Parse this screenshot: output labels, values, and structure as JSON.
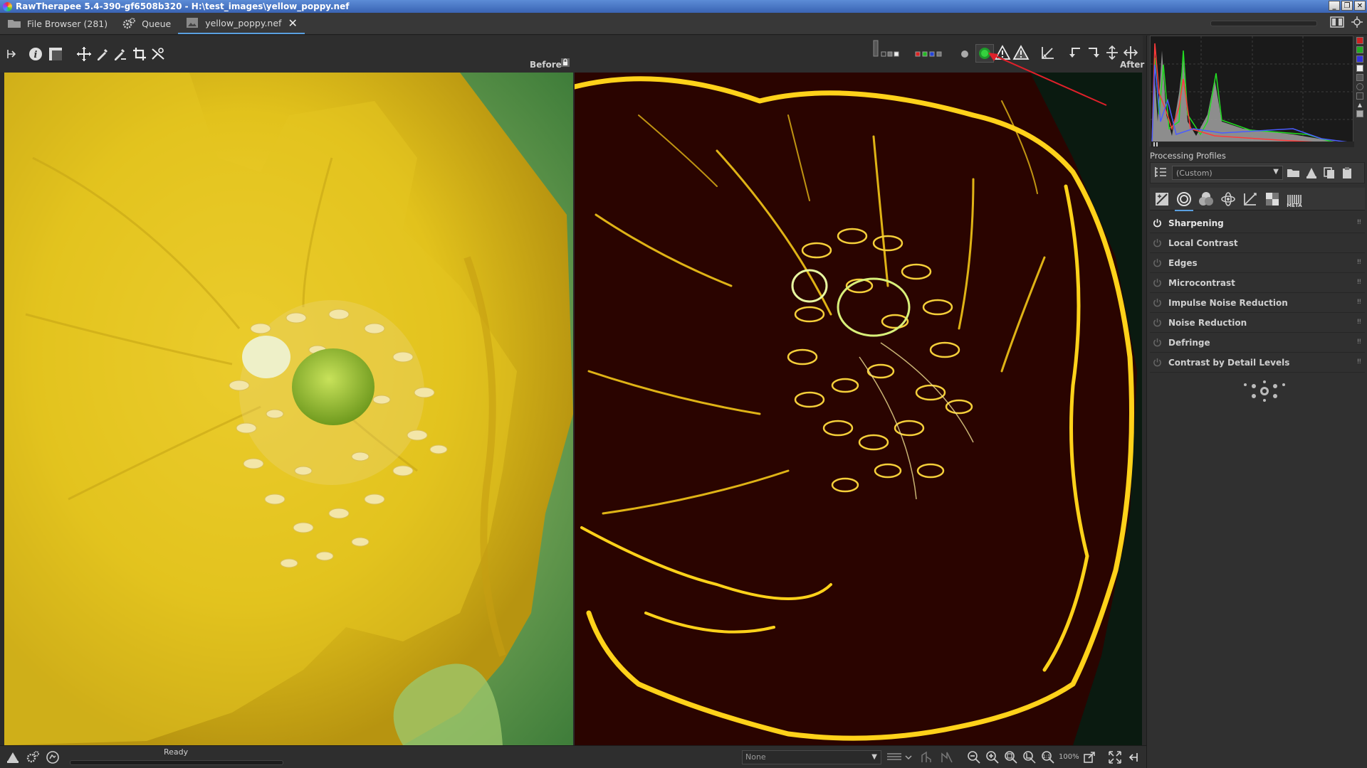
{
  "window": {
    "title": "RawTherapee 5.4-390-gf6508b320 - H:\\test_images\\yellow_poppy.nef",
    "controls": [
      "_",
      "❐",
      "✕"
    ]
  },
  "tabs": [
    {
      "label": "File Browser (281)",
      "icon": "folder-icon"
    },
    {
      "label": "Queue",
      "icon": "gears-icon"
    },
    {
      "label": "yellow_poppy.nef",
      "icon": "image-icon",
      "active": true
    }
  ],
  "toolbar": {
    "before_label": "Before",
    "after_label": "After"
  },
  "processing_profiles": {
    "title": "Processing Profiles",
    "selected": "(Custom)"
  },
  "tool_tabs": [
    {
      "icon": "exposure-tab-icon"
    },
    {
      "icon": "detail-tab-icon",
      "active": true
    },
    {
      "icon": "color-tab-icon"
    },
    {
      "icon": "advanced-tab-icon"
    },
    {
      "icon": "transform-tab-icon"
    },
    {
      "icon": "raw-tab-icon"
    },
    {
      "icon": "metadata-tab-icon",
      "label": "META"
    }
  ],
  "tools": [
    {
      "label": "Sharpening",
      "enabled": true
    },
    {
      "label": "Local Contrast",
      "enabled": false
    },
    {
      "label": "Edges",
      "enabled": false
    },
    {
      "label": "Microcontrast",
      "enabled": false
    },
    {
      "label": "Impulse Noise Reduction",
      "enabled": false
    },
    {
      "label": "Noise Reduction",
      "enabled": false
    },
    {
      "label": "Defringe",
      "enabled": false
    },
    {
      "label": "Contrast by Detail Levels",
      "enabled": false
    }
  ],
  "status": {
    "text": "Ready",
    "preview_select": "None",
    "zoom": "100%"
  },
  "colors": {
    "accent": "#5aa0e0",
    "petal": "#e8c41e",
    "mask_bg": "#2a0400",
    "mask_edge": "#ffd21a",
    "annotation_arrow": "#e0202a"
  }
}
